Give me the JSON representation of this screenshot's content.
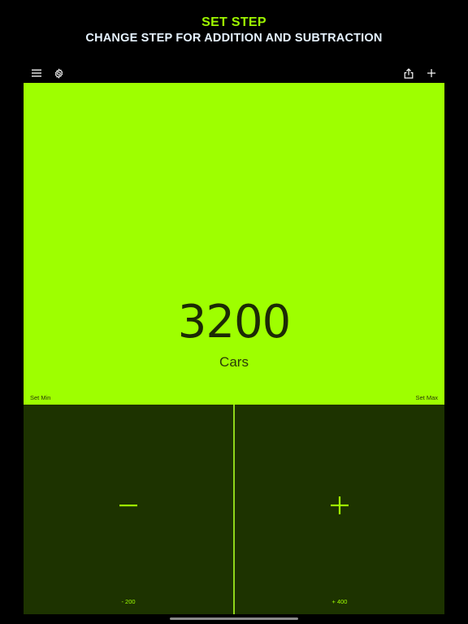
{
  "promo": {
    "title": "SET STEP",
    "subtitle": "CHANGE STEP FOR ADDITION AND SUBTRACTION"
  },
  "toolbar": {
    "menu_icon": "hamburger-menu-icon",
    "settings_icon": "gear-icon",
    "share_icon": "share-icon",
    "add_icon": "plus-icon"
  },
  "counter": {
    "value": "3200",
    "label": "Cars",
    "set_min_label": "Set Min",
    "set_max_label": "Set Max"
  },
  "controls": {
    "decrement_step": "- 200",
    "increment_step": "+ 400"
  },
  "colors": {
    "accent": "#9eff00",
    "display_bg": "#9eff00",
    "controls_bg": "#1d3300",
    "background": "#000000",
    "subtitle_text": "#e6f3ff"
  }
}
